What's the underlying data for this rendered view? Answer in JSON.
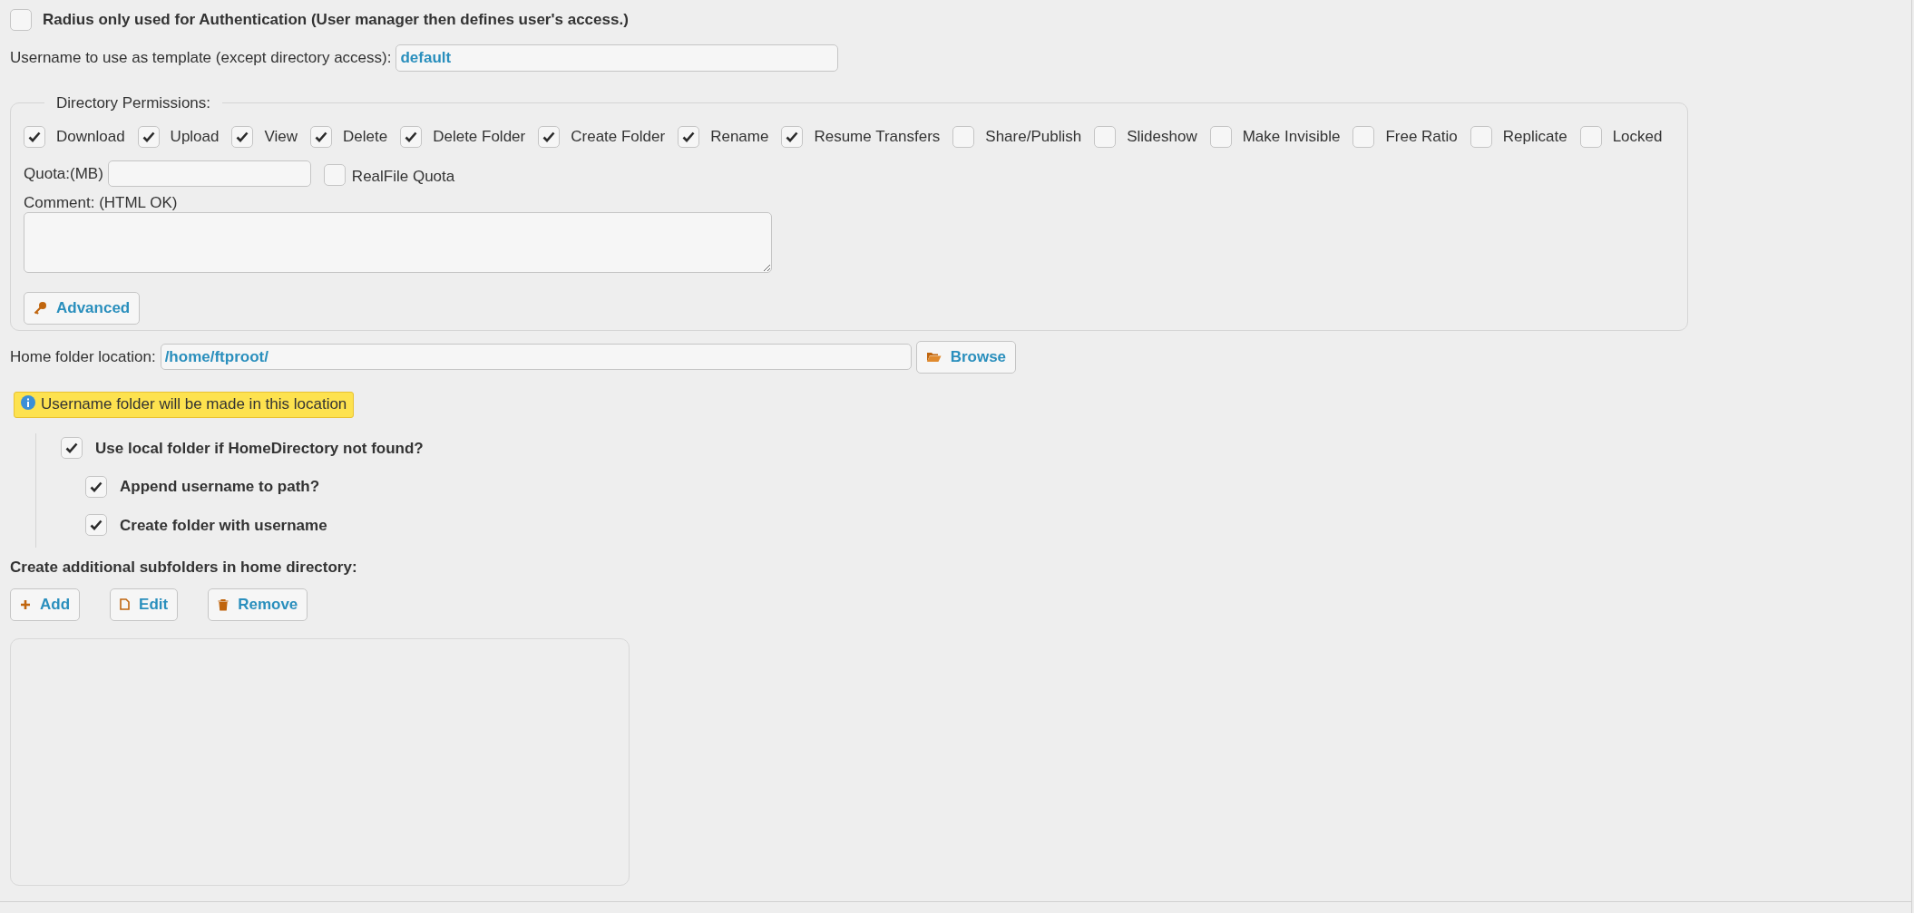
{
  "radius_only": {
    "label": "Radius only used for Authentication (User manager then defines user's access.)",
    "checked": false
  },
  "template": {
    "label": "Username to use as template (except directory access):",
    "value": "default"
  },
  "directory_permissions": {
    "legend": "Directory Permissions:",
    "permissions": [
      {
        "label": "Download",
        "checked": true
      },
      {
        "label": "Upload",
        "checked": true
      },
      {
        "label": "View",
        "checked": true
      },
      {
        "label": "Delete",
        "checked": true
      },
      {
        "label": "Delete Folder",
        "checked": true
      },
      {
        "label": "Create Folder",
        "checked": true
      },
      {
        "label": "Rename",
        "checked": true
      },
      {
        "label": "Resume Transfers",
        "checked": true
      },
      {
        "label": "Share/Publish",
        "checked": false
      },
      {
        "label": "Slideshow",
        "checked": false
      },
      {
        "label": "Make Invisible",
        "checked": false
      },
      {
        "label": "Free Ratio",
        "checked": false
      },
      {
        "label": "Replicate",
        "checked": false
      },
      {
        "label": "Locked",
        "checked": false
      }
    ],
    "quota_label": "Quota:(MB)",
    "realfile_quota": {
      "label": "RealFile Quota",
      "checked": false
    },
    "comment_label": "Comment: (HTML OK)",
    "advanced_button": "Advanced"
  },
  "home_folder": {
    "label": "Home folder location:",
    "value": "/home/ftproot/",
    "browse_button": "Browse"
  },
  "notice": "Username folder will be made in this location",
  "home_options": [
    {
      "label": "Use local folder if HomeDirectory not found?",
      "checked": true,
      "children": [
        {
          "label": "Append username to path?",
          "checked": true
        },
        {
          "label": "Create folder with username",
          "checked": true
        }
      ]
    }
  ],
  "subfolders": {
    "heading": "Create additional subfolders in home directory:",
    "buttons": [
      {
        "kind": "add",
        "label": "Add"
      },
      {
        "kind": "edit",
        "label": "Edit"
      },
      {
        "kind": "remove",
        "label": "Remove"
      }
    ]
  }
}
